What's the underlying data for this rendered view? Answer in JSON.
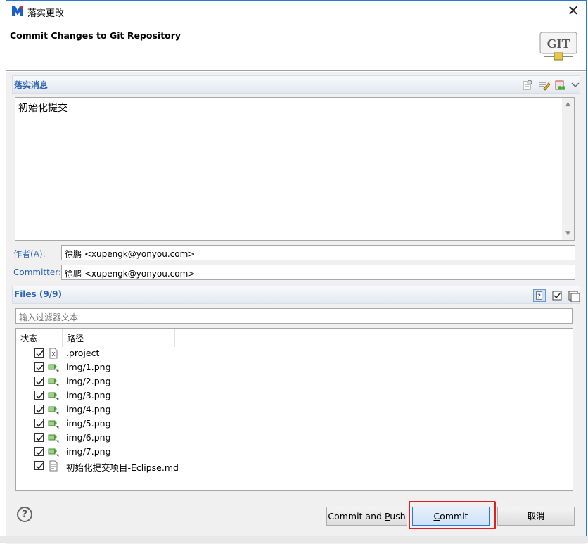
{
  "window": {
    "title": "落实更改",
    "close_glyph": "✕"
  },
  "header": {
    "title": "Commit Changes to Git Repository",
    "logo_text": "GIT"
  },
  "commit_message": {
    "section_title": "落实消息",
    "text": "初始化提交"
  },
  "author": {
    "label_prefix": "作者(",
    "label_mnemonic": "A",
    "label_suffix": "):",
    "value": "徐鹏 <xupengk@yonyou.com>"
  },
  "committer": {
    "label": "Committer:",
    "value": "徐鹏 <xupengk@yonyou.com>"
  },
  "files": {
    "section_title": "Files (9/9)",
    "filter_placeholder": "输入过滤器文本",
    "columns": [
      "状态",
      "路径"
    ],
    "rows": [
      {
        "name": ".project",
        "checked": true,
        "icon": "xml-file-icon"
      },
      {
        "name": "img/1.png",
        "checked": true,
        "icon": "new-file-icon"
      },
      {
        "name": "img/2.png",
        "checked": true,
        "icon": "new-file-icon"
      },
      {
        "name": "img/3.png",
        "checked": true,
        "icon": "new-file-icon"
      },
      {
        "name": "img/4.png",
        "checked": true,
        "icon": "new-file-icon"
      },
      {
        "name": "img/5.png",
        "checked": true,
        "icon": "new-file-icon"
      },
      {
        "name": "img/6.png",
        "checked": true,
        "icon": "new-file-icon"
      },
      {
        "name": "img/7.png",
        "checked": true,
        "icon": "new-file-icon"
      },
      {
        "name": "初始化提交项目-Eclipse.md",
        "checked": true,
        "icon": "text-file-icon"
      }
    ]
  },
  "buttons": {
    "commit_and_push_prefix": "Commit and ",
    "commit_and_push_mnemonic": "P",
    "commit_and_push_suffix": "ush",
    "commit_mnemonic": "C",
    "commit_suffix": "ommit",
    "cancel": "取消",
    "help": "?"
  },
  "colors": {
    "accent": "#2d64b3",
    "highlight": "#e02020"
  }
}
